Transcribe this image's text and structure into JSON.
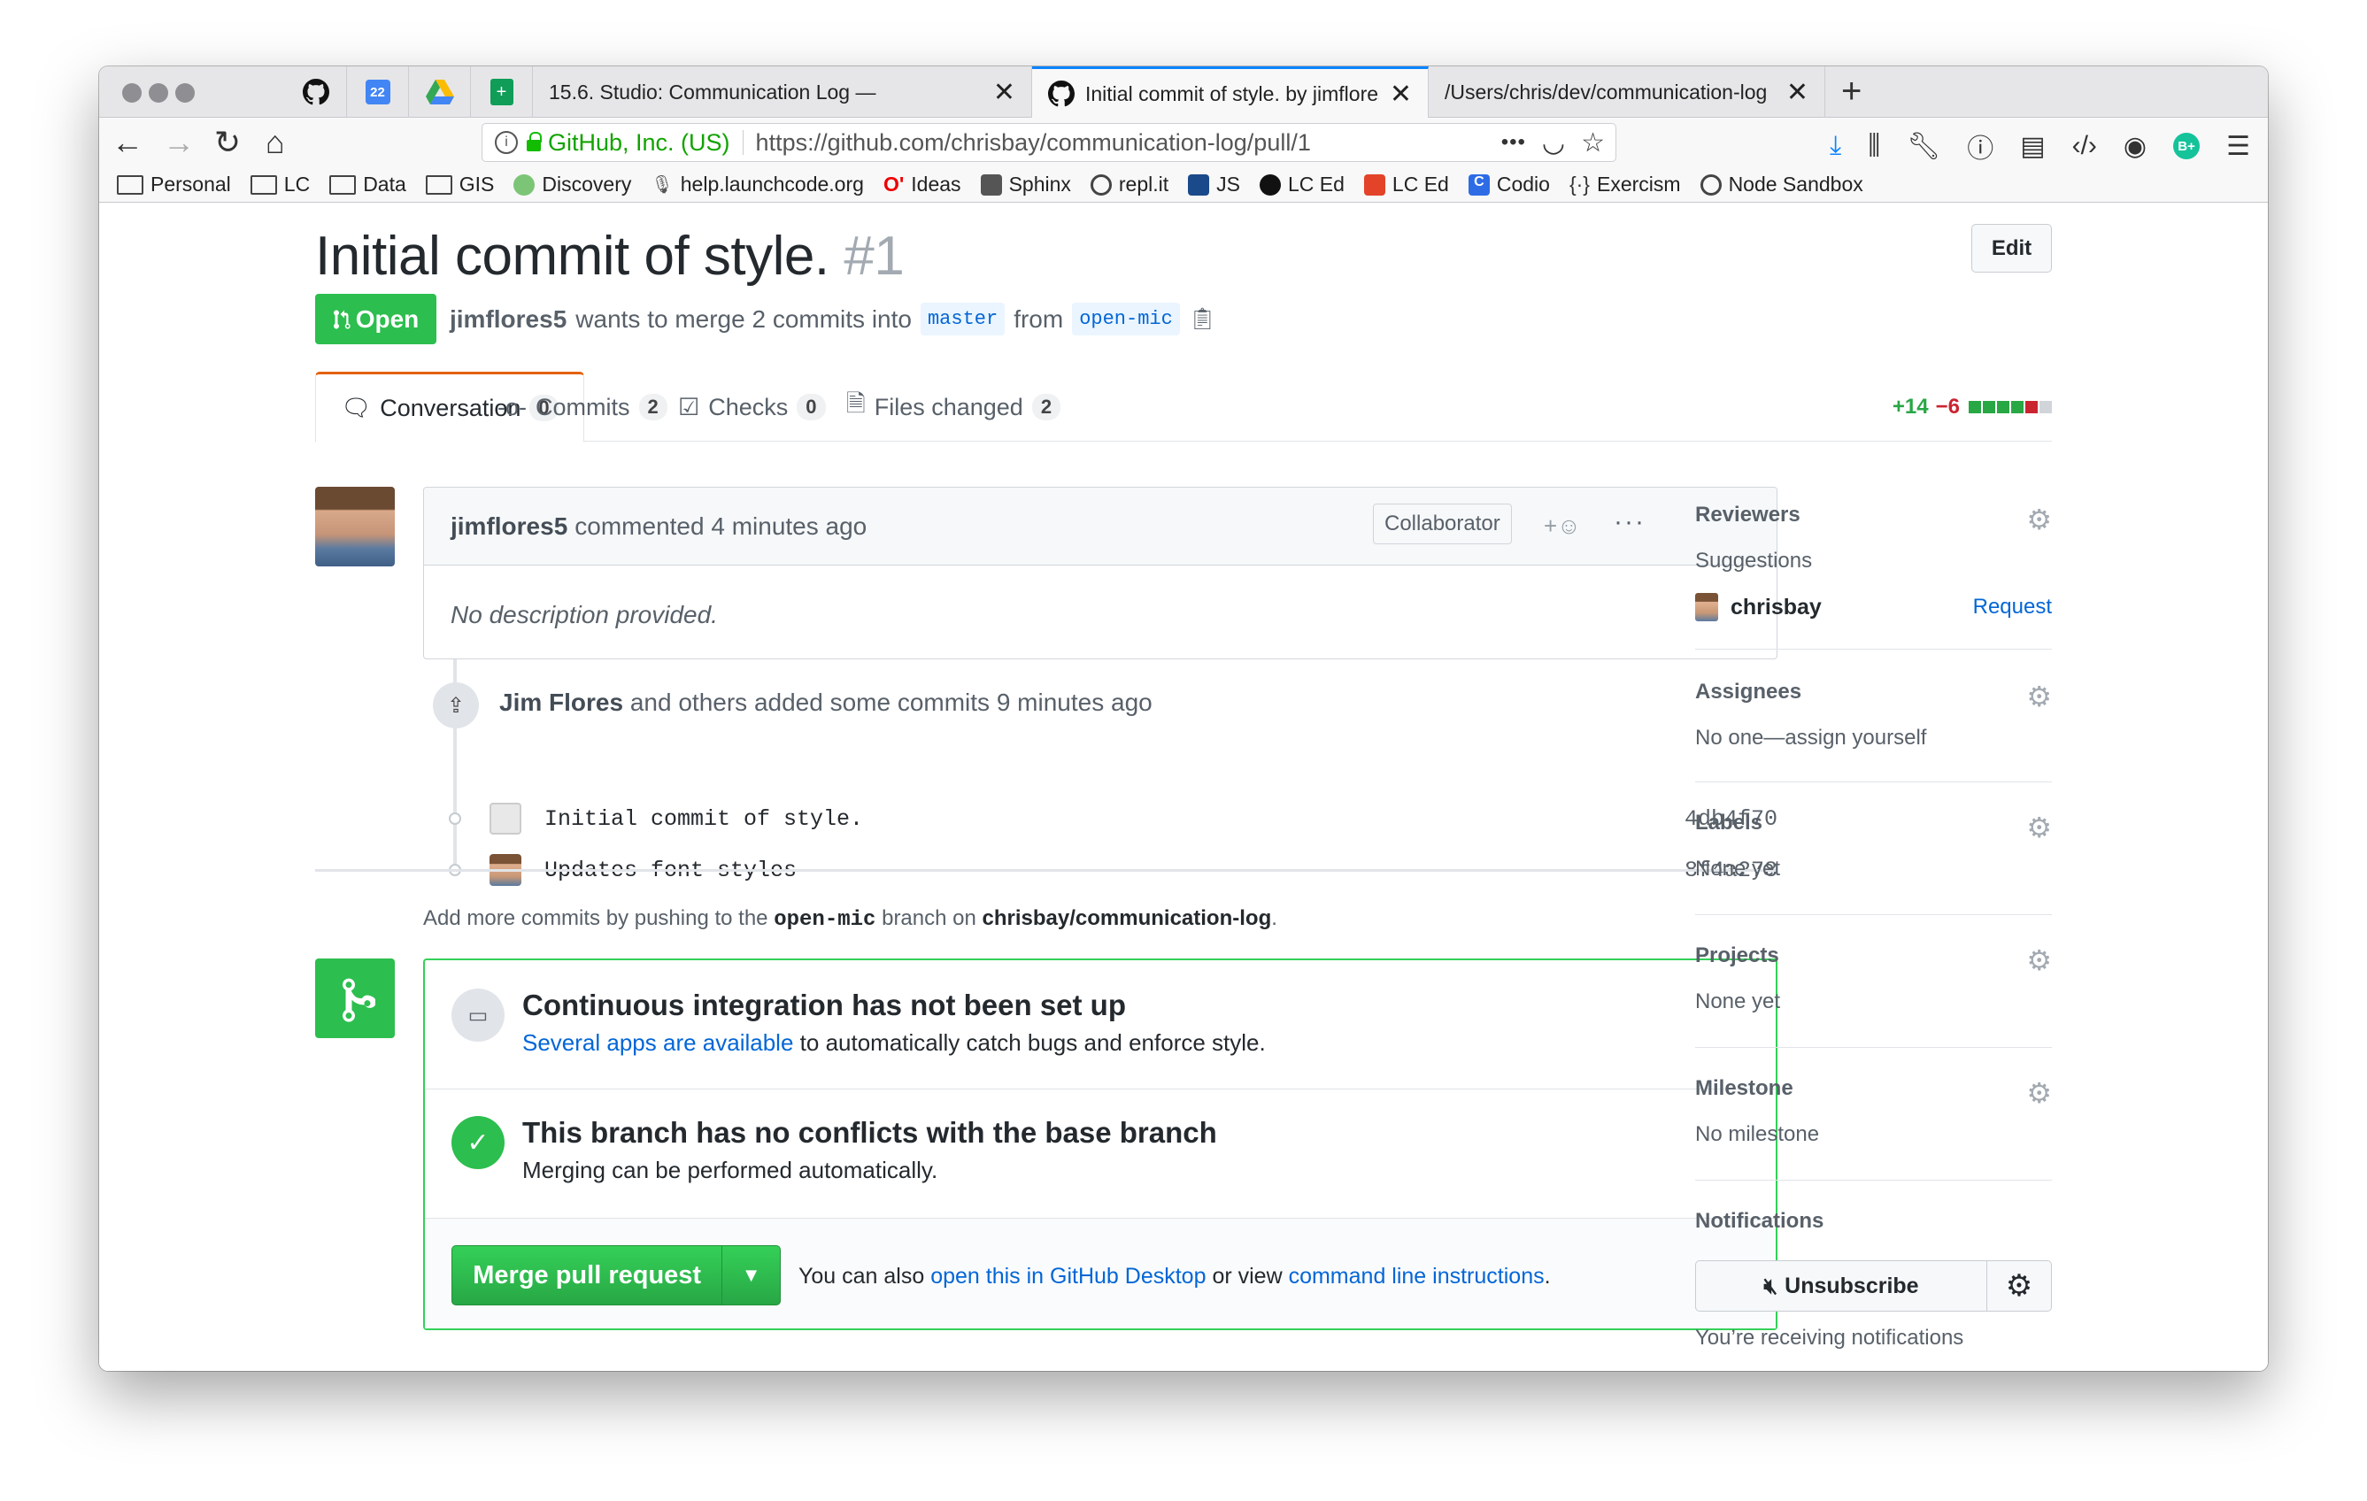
{
  "browser": {
    "tabs": [
      {
        "label": "15.6. Studio: Communication Log —",
        "active": false
      },
      {
        "label": "Initial commit of style. by jimflores",
        "active": true
      },
      {
        "label": "/Users/chris/dev/communication-log",
        "active": false
      }
    ],
    "new_tab": "+",
    "url_org": "GitHub, Inc. (US)",
    "url": "https://github.com/chrisbay/communication-log/pull/1",
    "url_more": "•••",
    "bookmarks": [
      "Personal",
      "LC",
      "Data",
      "GIS",
      "Discovery",
      "help.launchcode.org",
      "Ideas",
      "Sphinx",
      "repl.it",
      "JS",
      "LC Ed",
      "LC Ed",
      "Codio",
      "Exercism",
      "Node Sandbox"
    ]
  },
  "pr": {
    "title": "Initial commit of style.",
    "number": "#1",
    "edit_label": "Edit",
    "state": "Open",
    "author": "jimflores5",
    "meta_mid": "wants to merge 2 commits into",
    "base_branch": "master",
    "meta_from": "from",
    "head_branch": "open-mic"
  },
  "tabs": [
    {
      "label": "Conversation",
      "count": "0"
    },
    {
      "label": "Commits",
      "count": "2"
    },
    {
      "label": "Checks",
      "count": "0"
    },
    {
      "label": "Files changed",
      "count": "2"
    }
  ],
  "diffstat": {
    "additions": "+14",
    "deletions": "−6",
    "colors": [
      "#28a745",
      "#28a745",
      "#28a745",
      "#28a745",
      "#cb2431",
      "#d1d5da"
    ]
  },
  "comment": {
    "author": "jimflores5",
    "action": "commented 4 minutes ago",
    "badge": "Collaborator",
    "reaction": "+☺",
    "more": "···",
    "body": "No description provided."
  },
  "commits_event": {
    "author": "Jim Flores",
    "text": "and others added some commits 9 minutes ago",
    "commits": [
      {
        "message": "Initial commit of style.",
        "sha": "4db4f70"
      },
      {
        "message": "Updates font styles",
        "sha": "8f4a278"
      }
    ]
  },
  "push_note": {
    "pre": "Add more commits by pushing to the",
    "branch": "open-mic",
    "mid": "branch on",
    "repo": "chrisbay/communication-log",
    "end": "."
  },
  "merge": {
    "ci_title": "Continuous integration has not been set up",
    "ci_link": "Several apps are available",
    "ci_text": "to automatically catch bugs and enforce style.",
    "conflict_title": "This branch has no conflicts with the base branch",
    "conflict_text": "Merging can be performed automatically.",
    "button": "Merge pull request",
    "also_pre": "You can also",
    "also_link1": "open this in GitHub Desktop",
    "also_mid": "or view",
    "also_link2": "command line instructions",
    "also_end": "."
  },
  "sidebar": {
    "reviewers": {
      "title": "Reviewers",
      "sub": "Suggestions",
      "user": "chrisbay",
      "action": "Request"
    },
    "assignees": {
      "title": "Assignees",
      "text": "No one—assign yourself"
    },
    "labels": {
      "title": "Labels",
      "text": "None yet"
    },
    "projects": {
      "title": "Projects",
      "text": "None yet"
    },
    "milestone": {
      "title": "Milestone",
      "text": "No milestone"
    },
    "notifications": {
      "title": "Notifications",
      "button": "Unsubscribe",
      "text": "You’re receiving notifications"
    }
  }
}
